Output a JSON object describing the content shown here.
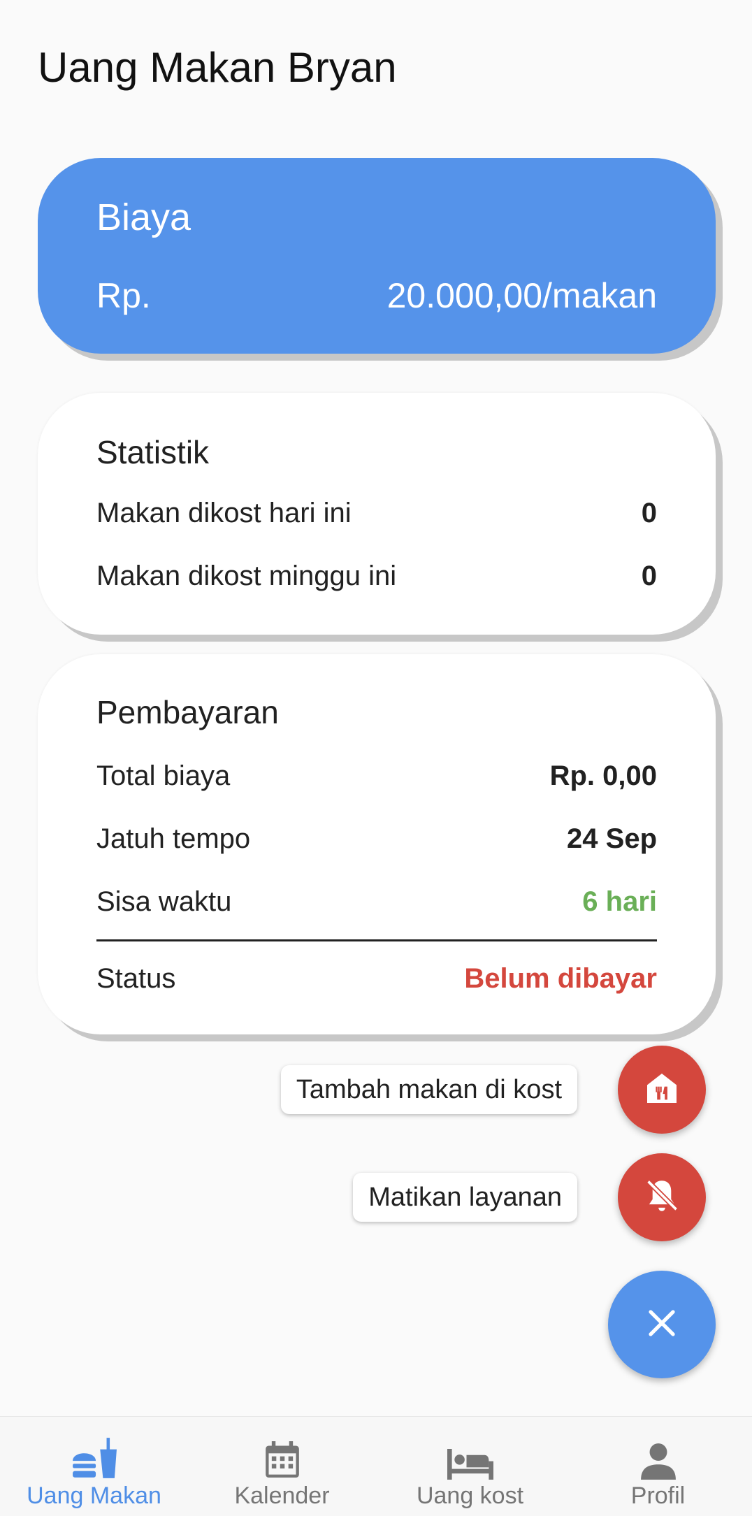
{
  "header": {
    "title": "Uang Makan Bryan"
  },
  "cost_card": {
    "title": "Biaya",
    "prefix": "Rp.",
    "amount": "20.000,00/makan",
    "color": "#5593ea"
  },
  "stats_card": {
    "title": "Statistik",
    "rows": [
      {
        "label": "Makan dikost hari ini",
        "value": "0"
      },
      {
        "label": "Makan dikost minggu ini",
        "value": "0"
      }
    ]
  },
  "payment_card": {
    "title": "Pembayaran",
    "rows": [
      {
        "label": "Total biaya",
        "value": "Rp. 0,00"
      },
      {
        "label": "Jatuh tempo",
        "value": "24 Sep"
      },
      {
        "label": "Sisa waktu",
        "value": "6 hari",
        "color": "#6aaf57"
      }
    ],
    "status_label": "Status",
    "status_value": "Belum dibayar",
    "status_color": "#d4473d"
  },
  "fab_menu": {
    "add_meal_label": "Tambah makan di kost",
    "add_meal_icon": "house-cutlery-icon",
    "disable_service_label": "Matikan layanan",
    "disable_service_icon": "bell-off-icon",
    "close_icon": "close-icon"
  },
  "bottom_nav": {
    "items": [
      {
        "label": "Uang Makan",
        "icon": "burger-drink-icon",
        "active": true
      },
      {
        "label": "Kalender",
        "icon": "calendar-icon",
        "active": false
      },
      {
        "label": "Uang kost",
        "icon": "bed-icon",
        "active": false
      },
      {
        "label": "Profil",
        "icon": "person-icon",
        "active": false
      }
    ],
    "active_color": "#4f8ee6"
  }
}
